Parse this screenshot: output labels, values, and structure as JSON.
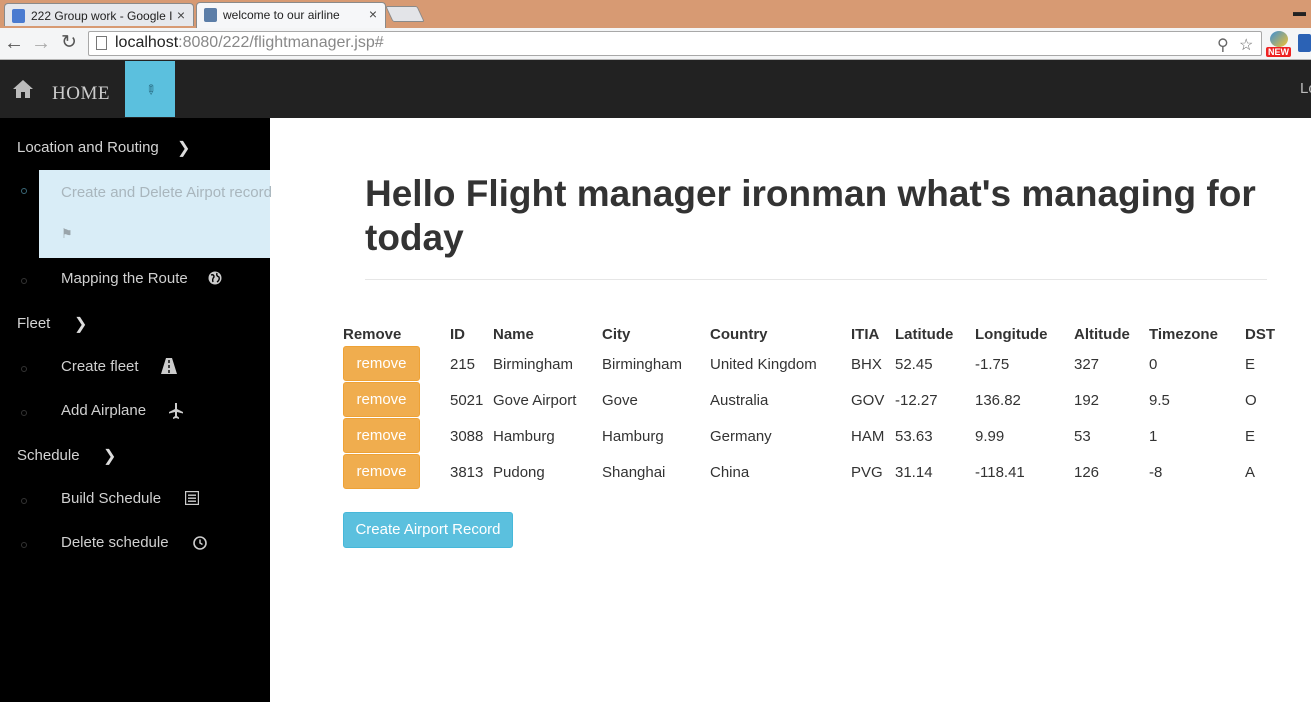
{
  "browser": {
    "tabs": [
      {
        "title": "222 Group work - Google I",
        "favicon_color": "#4a7bd0"
      },
      {
        "title": "welcome to our airline",
        "favicon_color": "#5c7ea8"
      }
    ],
    "close_glyph": "×",
    "minimize_glyph": "▬",
    "url_host": "localhost",
    "url_rest": ":8080/222/flightmanager.jsp#",
    "ext_badge": "NEW"
  },
  "navbar": {
    "home_label": "HOME",
    "right_text": "Lo",
    "bg_color": "#222222",
    "active_color": "#5bc0de"
  },
  "sidebar": {
    "sections": [
      {
        "label": "Location and Routing",
        "items": [
          {
            "label": "Create and Delete Airpot record",
            "icon": "flag-icon",
            "selected": true
          },
          {
            "label": "Mapping the Route",
            "icon": "globe-icon"
          }
        ]
      },
      {
        "label": "Fleet",
        "items": [
          {
            "label": "Create fleet",
            "icon": "road-icon"
          },
          {
            "label": "Add Airplane",
            "icon": "plane-icon"
          }
        ]
      },
      {
        "label": "Schedule",
        "items": [
          {
            "label": "Build Schedule",
            "icon": "list-icon"
          },
          {
            "label": "Delete schedule",
            "icon": "clock-icon"
          }
        ]
      }
    ]
  },
  "main": {
    "heading": "Hello Flight manager ironman what's managing for today",
    "table": {
      "headers": [
        "Remove",
        "ID",
        "Name",
        "City",
        "Country",
        "ITIA",
        "Latitude",
        "Longitude",
        "Altitude",
        "Timezone",
        "DST"
      ],
      "remove_label": "remove",
      "rows": [
        [
          "215",
          "Birmingham",
          "Birmingham",
          "United Kingdom",
          "BHX",
          "52.45",
          "-1.75",
          "327",
          "0",
          "E"
        ],
        [
          "5021",
          "Gove Airport",
          "Gove",
          "Australia",
          "GOV",
          "-12.27",
          "136.82",
          "192",
          "9.5",
          "O"
        ],
        [
          "3088",
          "Hamburg",
          "Hamburg",
          "Germany",
          "HAM",
          "53.63",
          "9.99",
          "53",
          "1",
          "E"
        ],
        [
          "3813",
          "Pudong",
          "Shanghai",
          "China",
          "PVG",
          "31.14",
          "-118.41",
          "126",
          "-8",
          "A"
        ]
      ]
    },
    "create_button": "Create Airport Record",
    "colors": {
      "warning": "#f0ad4e",
      "info": "#5bc0de"
    }
  }
}
